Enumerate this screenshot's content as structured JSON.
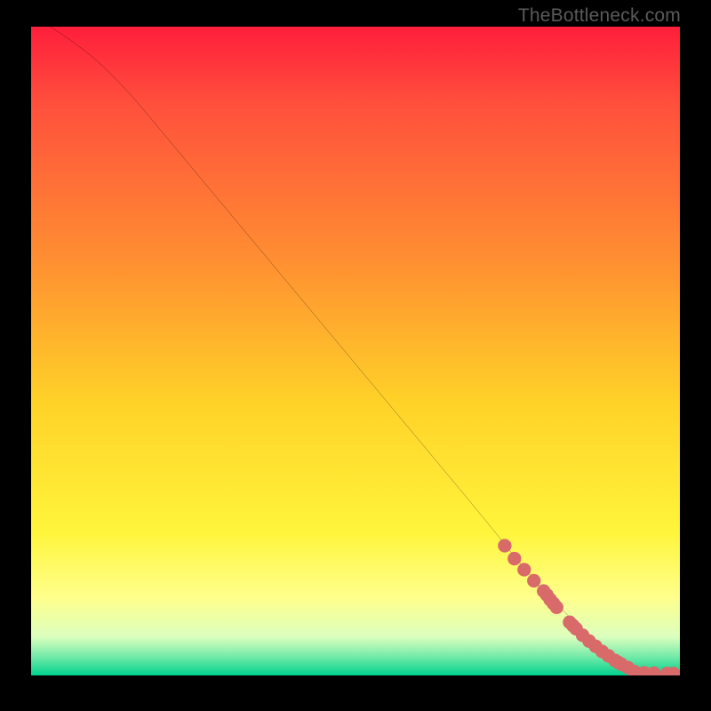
{
  "credit_text": "TheBottleneck.com",
  "chart_data": {
    "type": "line",
    "title": "",
    "xlabel": "",
    "ylabel": "",
    "xlim": [
      0,
      100
    ],
    "ylim": [
      0,
      100
    ],
    "grid": false,
    "curve": {
      "name": "bottleneck-curve",
      "x": [
        3,
        6,
        10,
        15,
        20,
        30,
        40,
        50,
        60,
        70,
        78,
        84,
        88,
        92,
        95,
        98,
        100
      ],
      "y": [
        100,
        98,
        95,
        90,
        84,
        72,
        60,
        48,
        36,
        24,
        14,
        8,
        4,
        1.8,
        0.8,
        0.3,
        0.2
      ]
    },
    "series": [
      {
        "name": "highlight-points",
        "type": "scatter",
        "color": "#d86a6a",
        "x": [
          73,
          74.5,
          76,
          77.5,
          79,
          79.5,
          80,
          80.5,
          81,
          83,
          83.5,
          84,
          85,
          86,
          87,
          88,
          89,
          90,
          90.5,
          91,
          92,
          93,
          94.5,
          96,
          98,
          99
        ],
        "y": [
          20,
          18,
          16.3,
          14.6,
          13,
          12.4,
          11.7,
          11.1,
          10.5,
          8.2,
          7.7,
          7.2,
          6.2,
          5.3,
          4.5,
          3.7,
          3,
          2.3,
          2,
          1.7,
          1.2,
          0.6,
          0.4,
          0.35,
          0.3,
          0.3
        ]
      }
    ],
    "background": {
      "type": "vertical-gradient",
      "stops": [
        {
          "pos": 0.0,
          "color": "#ff1e3c"
        },
        {
          "pos": 0.35,
          "color": "#ff8c32"
        },
        {
          "pos": 0.78,
          "color": "#fff53c"
        },
        {
          "pos": 0.94,
          "color": "#dcffbe"
        },
        {
          "pos": 1.0,
          "color": "#00d28c"
        }
      ]
    }
  }
}
